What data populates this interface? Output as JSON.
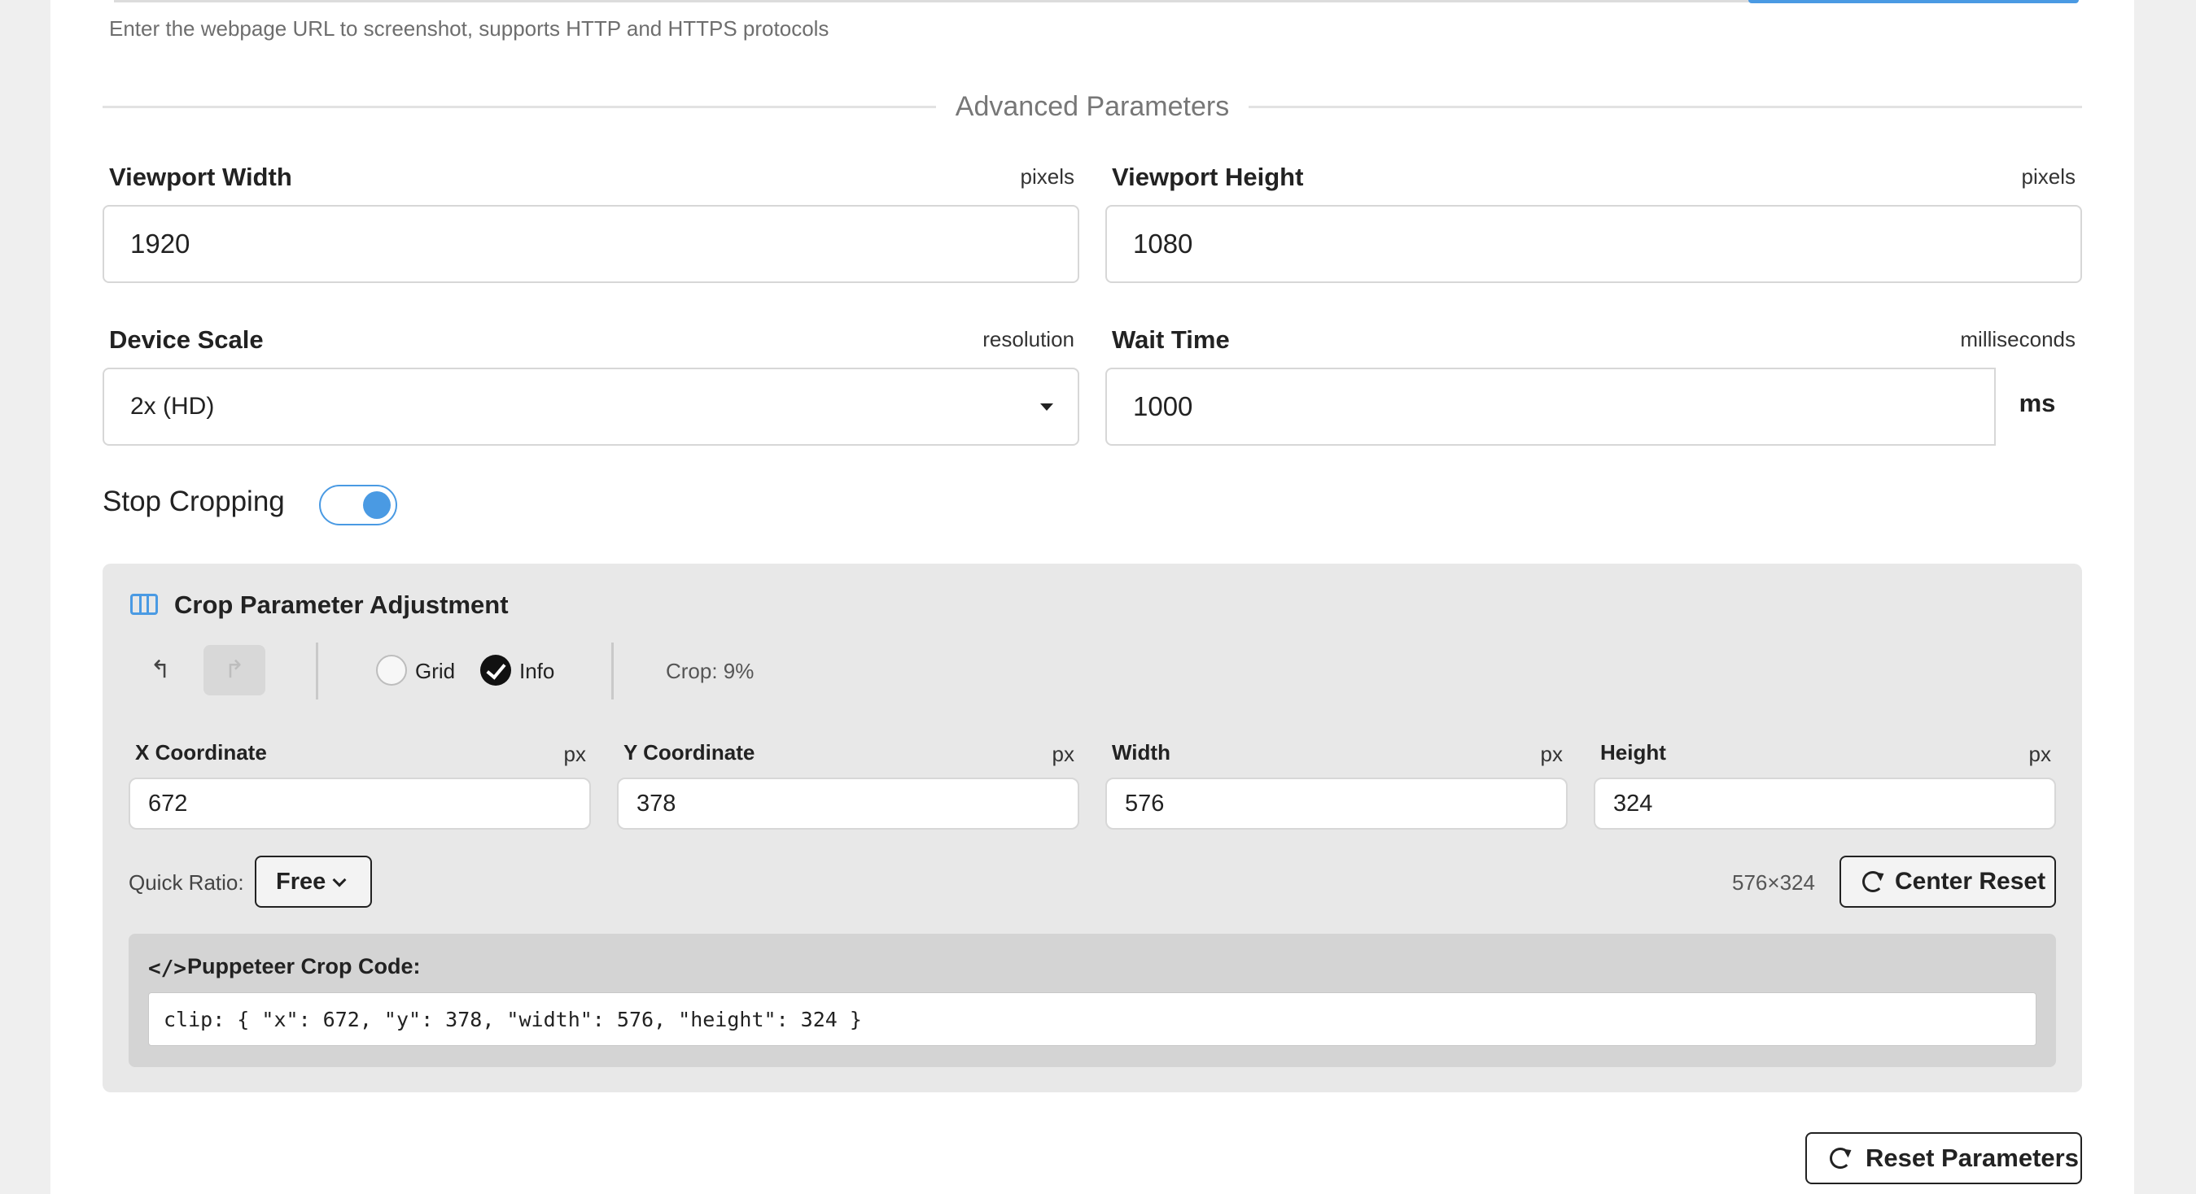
{
  "url_hint": "Enter the webpage URL to screenshot, supports HTTP and HTTPS protocols",
  "advanced": {
    "title": "Advanced Parameters",
    "viewport_width": {
      "label": "Viewport Width",
      "unit": "pixels",
      "value": "1920"
    },
    "viewport_height": {
      "label": "Viewport Height",
      "unit": "pixels",
      "value": "1080"
    },
    "device_scale": {
      "label": "Device Scale",
      "unit": "resolution",
      "value": "2x (HD)"
    },
    "wait_time": {
      "label": "Wait Time",
      "unit": "milliseconds",
      "value": "1000",
      "suffix": "ms"
    },
    "stop_cropping": {
      "label": "Stop Cropping",
      "enabled": true
    }
  },
  "crop": {
    "title": "Crop Parameter Adjustment",
    "toolbar": {
      "undo_icon": "↰",
      "redo_icon": "↱",
      "grid_label": "Grid",
      "grid_checked": false,
      "info_label": "Info",
      "info_checked": true,
      "crop_percent": "Crop: 9%"
    },
    "fields": {
      "x": {
        "label": "X Coordinate",
        "unit": "px",
        "value": "672"
      },
      "y": {
        "label": "Y Coordinate",
        "unit": "px",
        "value": "378"
      },
      "width": {
        "label": "Width",
        "unit": "px",
        "value": "576"
      },
      "height": {
        "label": "Height",
        "unit": "px",
        "value": "324"
      }
    },
    "quick_ratio": {
      "label": "Quick Ratio:",
      "value": "Free"
    },
    "dimensions": "576×324",
    "center_reset_label": "Center Reset",
    "code": {
      "icon": "</>",
      "title": "Puppeteer Crop Code:",
      "value": "clip: { \"x\": 672, \"y\": 378, \"width\": 576, \"height\": 324 }"
    }
  },
  "reset_params_label": "Reset Parameters",
  "colors": {
    "accent": "#4a9ae3",
    "panel": "#e8e8e8",
    "code_panel": "#d4d4d4"
  }
}
